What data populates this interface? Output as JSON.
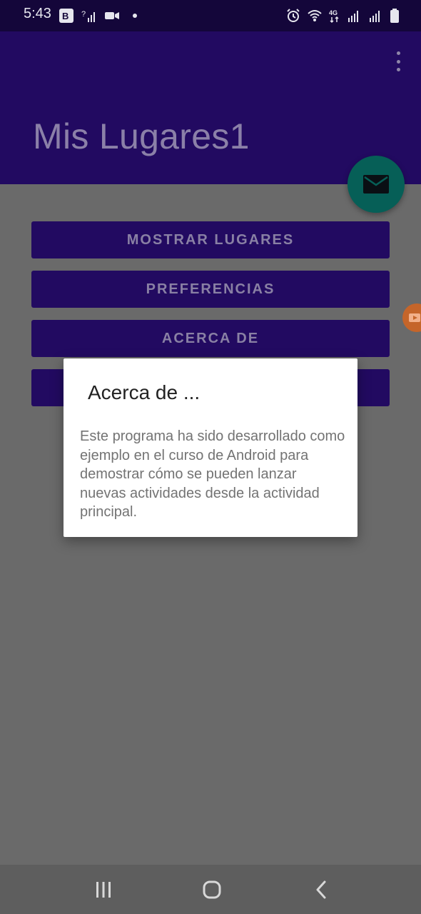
{
  "status_bar": {
    "time": "5:43",
    "left_icons": [
      "b-app-icon",
      "no-signal-icon",
      "video-call-icon",
      "notification-dot-icon"
    ],
    "right_icons": [
      "alarm-icon",
      "wifi-icon",
      "4g-icon",
      "signal-icon",
      "signal-icon-2",
      "battery-icon"
    ],
    "network_label": "4G"
  },
  "app_bar": {
    "title": "Mis Lugares1",
    "overflow_icon": "more-vert-icon"
  },
  "fab": {
    "icon": "mail-icon",
    "color": "#065f57"
  },
  "buttons": [
    {
      "label": "MOSTRAR LUGARES"
    },
    {
      "label": "PREFERENCIAS"
    },
    {
      "label": "ACERCA DE"
    },
    {
      "label": ""
    }
  ],
  "dialog": {
    "title": "Acerca de ...",
    "message": "Este programa ha sido desarrollado como ejemplo en el curso de Android para demostrar cómo se pueden lanzar nuevas actividades desde la actividad principal."
  },
  "colors": {
    "primary": "#220a61",
    "status_bar": "#14063a",
    "scrim": "#6a6a6a",
    "accent": "#065f57"
  },
  "nav_bar": {
    "icons": [
      "recent-apps-icon",
      "home-icon",
      "back-icon"
    ]
  }
}
